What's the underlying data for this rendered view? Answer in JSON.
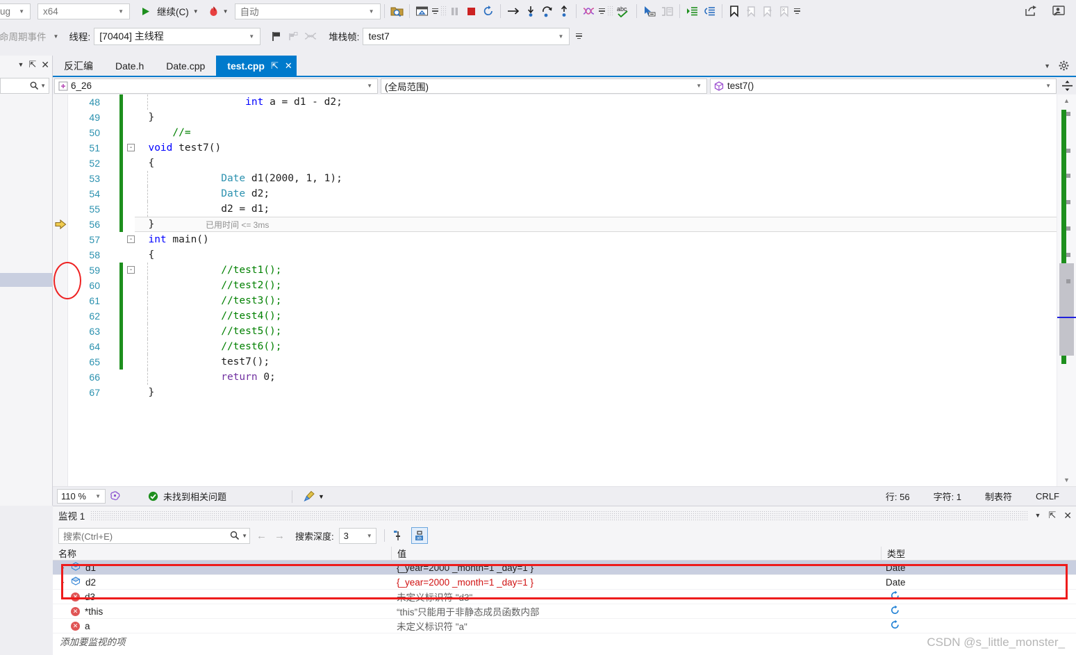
{
  "toolbar": {
    "config_combo": "ug",
    "platform_combo": "x64",
    "continue_label": "继续(C)",
    "hot_reload_icon": "hot-reload-icon",
    "auto_combo": "自动",
    "icons": [
      "open-folder-search-icon",
      "show-next-statement-icon",
      "pause-icon",
      "stop-icon",
      "restart-icon",
      "step-over-icon",
      "step-into-icon",
      "step-out-return-icon",
      "step-out-icon",
      "threads-icon",
      "spell-check-icon",
      "select-tool-icon",
      "comment-icon",
      "indent-icon",
      "outdent-icon",
      "bookmark-icon",
      "prev-bookmark-icon",
      "next-bookmark-icon",
      "clear-bookmark-icon"
    ],
    "share_icon": "share-icon",
    "feedback_icon": "send-feedback-icon"
  },
  "debug_bar": {
    "lifecycle_events": "命周期事件",
    "thread_label": "线程:",
    "thread_value": "[70404] 主线程",
    "flag_icon": "flag-icon",
    "flag_filtered_icon": "flag-filter-icon",
    "link_icon": "link-threads-icon",
    "stackframe_label": "堆栈帧:",
    "stackframe_value": "test7"
  },
  "left_dock": {
    "menu_icon": "chevron-down-icon",
    "pin_icon": "pin-icon",
    "close_icon": "close-icon",
    "search_icon": "search-icon"
  },
  "tabs": [
    {
      "label": "反汇编",
      "active": false
    },
    {
      "label": "Date.h",
      "active": false
    },
    {
      "label": "Date.cpp",
      "active": false
    },
    {
      "label": "test.cpp",
      "active": true
    }
  ],
  "tab_strip": {
    "pin_icon": "pin-icon",
    "close_icon": "close-icon",
    "overflow_icon": "chevron-down-icon",
    "settings_icon": "gear-icon"
  },
  "navbar": {
    "project_icon": "project-icon",
    "project": "6_26",
    "scope": "(全局范围)",
    "member_icon": "method-cube-icon",
    "member": "test7()",
    "splitter_icon": "split-view-icon"
  },
  "code": {
    "current_line_tip": "已用时间 <= 3ms",
    "exec_arrow_icon": "execution-pointer-icon",
    "lines": [
      {
        "n": 48,
        "indent": 4,
        "tokens": [
          {
            "t": "int ",
            "c": "blue"
          },
          {
            "t": "a = d1 - d2;",
            "c": "black"
          }
        ],
        "green": true,
        "guides": [
          136
        ]
      },
      {
        "n": 49,
        "indent": 0,
        "tokens": [
          {
            "t": "}",
            "c": "black"
          }
        ],
        "green": true,
        "guides": []
      },
      {
        "n": 50,
        "indent": 1,
        "tokens": [
          {
            "t": "//=",
            "c": "green"
          }
        ],
        "green": true,
        "guides": []
      },
      {
        "n": 51,
        "indent": 0,
        "tokens": [
          {
            "t": "void ",
            "c": "blue"
          },
          {
            "t": "test7()",
            "c": "black"
          }
        ],
        "green": true,
        "fold": "-",
        "guides": []
      },
      {
        "n": 52,
        "indent": 0,
        "tokens": [
          {
            "t": "{",
            "c": "black"
          }
        ],
        "green": true,
        "guides": []
      },
      {
        "n": 53,
        "indent": 3,
        "tokens": [
          {
            "t": "Date",
            "c": "teal"
          },
          {
            "t": " d1(2000, 1, 1);",
            "c": "black"
          }
        ],
        "green": true,
        "guides": [
          136
        ]
      },
      {
        "n": 54,
        "indent": 3,
        "tokens": [
          {
            "t": "Date",
            "c": "teal"
          },
          {
            "t": " d2;",
            "c": "black"
          }
        ],
        "green": true,
        "guides": [
          136
        ]
      },
      {
        "n": 55,
        "indent": 3,
        "tokens": [
          {
            "t": "d2 = d1;",
            "c": "black"
          }
        ],
        "green": true,
        "guides": [
          136
        ]
      },
      {
        "n": 56,
        "indent": 0,
        "tokens": [
          {
            "t": "}",
            "c": "black"
          }
        ],
        "green": true,
        "current": true,
        "guides": []
      },
      {
        "n": 57,
        "indent": 0,
        "tokens": [
          {
            "t": "int ",
            "c": "blue"
          },
          {
            "t": "main()",
            "c": "black"
          }
        ],
        "green": false,
        "fold": "-",
        "guides": []
      },
      {
        "n": 58,
        "indent": 0,
        "tokens": [
          {
            "t": "{",
            "c": "black"
          }
        ],
        "green": false,
        "guides": []
      },
      {
        "n": 59,
        "indent": 3,
        "tokens": [
          {
            "t": "//test1();",
            "c": "green"
          }
        ],
        "green": true,
        "fold": "-",
        "guides": [
          136
        ]
      },
      {
        "n": 60,
        "indent": 3,
        "tokens": [
          {
            "t": "//test2();",
            "c": "green"
          }
        ],
        "green": true,
        "guides": [
          136
        ]
      },
      {
        "n": 61,
        "indent": 3,
        "tokens": [
          {
            "t": "//test3();",
            "c": "green"
          }
        ],
        "green": true,
        "guides": [
          136
        ]
      },
      {
        "n": 62,
        "indent": 3,
        "tokens": [
          {
            "t": "//test4();",
            "c": "green"
          }
        ],
        "green": true,
        "guides": [
          136
        ]
      },
      {
        "n": 63,
        "indent": 3,
        "tokens": [
          {
            "t": "//test5();",
            "c": "green"
          }
        ],
        "green": true,
        "guides": [
          136
        ]
      },
      {
        "n": 64,
        "indent": 3,
        "tokens": [
          {
            "t": "//test6();",
            "c": "green"
          }
        ],
        "green": true,
        "guides": [
          136
        ]
      },
      {
        "n": 65,
        "indent": 3,
        "tokens": [
          {
            "t": "test7();",
            "c": "black"
          }
        ],
        "green": true,
        "guides": [
          136
        ]
      },
      {
        "n": 66,
        "indent": 3,
        "tokens": [
          {
            "t": "return ",
            "c": "purple"
          },
          {
            "t": "0;",
            "c": "black"
          }
        ],
        "green": false,
        "guides": [
          136
        ]
      },
      {
        "n": 67,
        "indent": 0,
        "tokens": [
          {
            "t": "}",
            "c": "black"
          }
        ],
        "green": false,
        "guides": []
      }
    ]
  },
  "editor_status": {
    "zoom": "110 %",
    "intellisense_icon": "intellisense-icon",
    "problems_icon": "check-circle-icon",
    "problems_text": "未找到相关问题",
    "cleanup_icon": "code-cleanup-icon",
    "line_label": "行: 56",
    "char_label": "字符: 1",
    "tabs_label": "制表符",
    "eol_label": "CRLF"
  },
  "watch": {
    "title": "监视 1",
    "menu_icon": "chevron-down-icon",
    "pin_icon": "pin-icon",
    "close_icon": "close-icon",
    "search_placeholder": "搜索(Ctrl+E)",
    "search_icon": "search-icon",
    "search_dropdown_icon": "chevron-down-icon",
    "prev_icon": "arrow-left-icon",
    "next_icon": "arrow-right-icon",
    "depth_label": "搜索深度:",
    "depth_value": "3",
    "pin_column_icon": "pin-column-icon",
    "hex_display_icon": "hex-display-icon",
    "columns": [
      "名称",
      "值",
      "类型"
    ],
    "rows": [
      {
        "expander": "▸",
        "icon": "object-icon",
        "name": "d1",
        "value": "{_year=2000 _month=1 _day=1 }",
        "value_state": "normal",
        "type": "Date",
        "selected": true,
        "refresh": false
      },
      {
        "expander": "▸",
        "icon": "object-icon",
        "name": "d2",
        "value": "{_year=2000 _month=1 _day=1 }",
        "value_state": "changed",
        "type": "Date",
        "selected": false,
        "refresh": false
      },
      {
        "expander": "",
        "icon": "error-icon",
        "name": "d3",
        "value": "未定义标识符 \"d3\"",
        "value_state": "muted",
        "type": "",
        "selected": false,
        "refresh": true
      },
      {
        "expander": "",
        "icon": "error-icon",
        "name": "*this",
        "value": "“this”只能用于非静态成员函数内部",
        "value_state": "muted",
        "type": "",
        "selected": false,
        "refresh": true
      },
      {
        "expander": "",
        "icon": "error-icon",
        "name": "a",
        "value": "未定义标识符 \"a\"",
        "value_state": "muted",
        "type": "",
        "selected": false,
        "refresh": true
      }
    ],
    "add_item_placeholder": "添加要监视的项"
  },
  "watermark": "CSDN @s_little_monster_",
  "colors": {
    "accent": "#007acc",
    "highlight_red": "#ee1c1c",
    "change_green": "#1e8f1e",
    "selection": "#c9cfe0",
    "error_value_red": "#d01010"
  }
}
